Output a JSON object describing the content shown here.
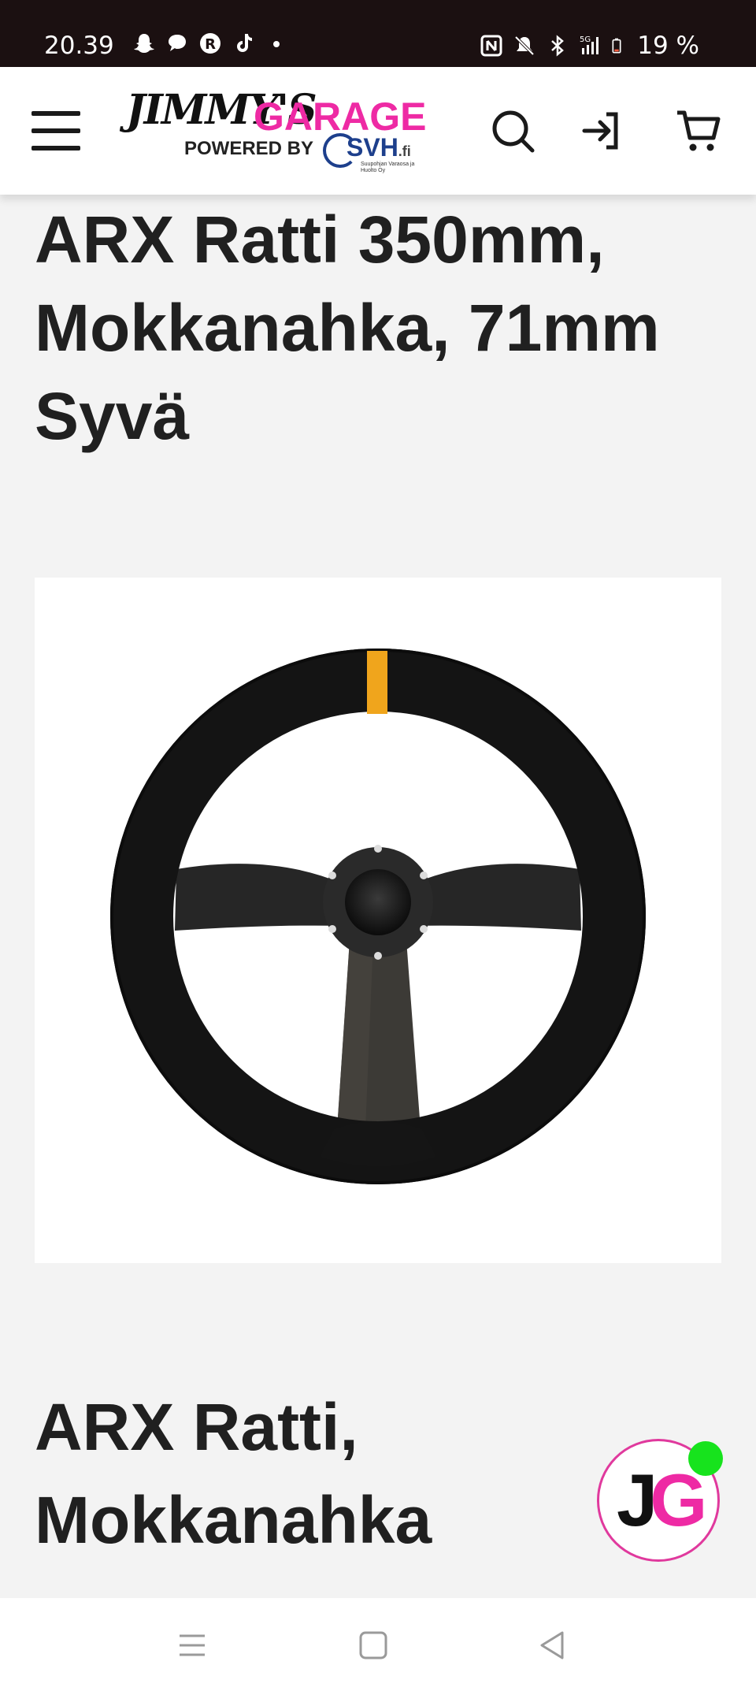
{
  "status_bar": {
    "time": "20.39",
    "battery": "19 %",
    "network": "5G",
    "notification_icons": [
      "snapchat-icon",
      "chat-bubble-icon",
      "r-app-icon",
      "tiktok-icon",
      "more-dot-icon"
    ],
    "system_icons": [
      "nfc-icon",
      "mute-icon",
      "bluetooth-icon",
      "signal-icon",
      "battery-icon"
    ]
  },
  "header": {
    "logo": {
      "brand_part1": "JIMMY'S",
      "brand_part2": "GARAGE",
      "powered_by": "POWERED BY",
      "partner": "SVH",
      "partner_tld": ".fi",
      "partner_tagline": "Suupohjan Varaosa ja Huolto Oy"
    },
    "icons": [
      "menu-icon",
      "search-icon",
      "login-icon",
      "cart-icon"
    ]
  },
  "product": {
    "title": "ARX Ratti 350mm, Mokkanahka, 71mm Syvä",
    "image_alt": "steering-wheel-image",
    "subtitle": "ARX Ratti, Mokkanahka"
  },
  "chat_widget": {
    "initial_1": "J",
    "initial_2": "G",
    "online": true
  },
  "colors": {
    "brand_pink": "#ee2aa4",
    "status_bar_bg": "#1b1011",
    "page_bg": "#f3f3f3",
    "online_green": "#17e31d",
    "stripe_orange": "#f0a51c"
  },
  "nav_bar": {
    "buttons": [
      "recent-apps-icon",
      "home-icon",
      "back-icon"
    ]
  }
}
